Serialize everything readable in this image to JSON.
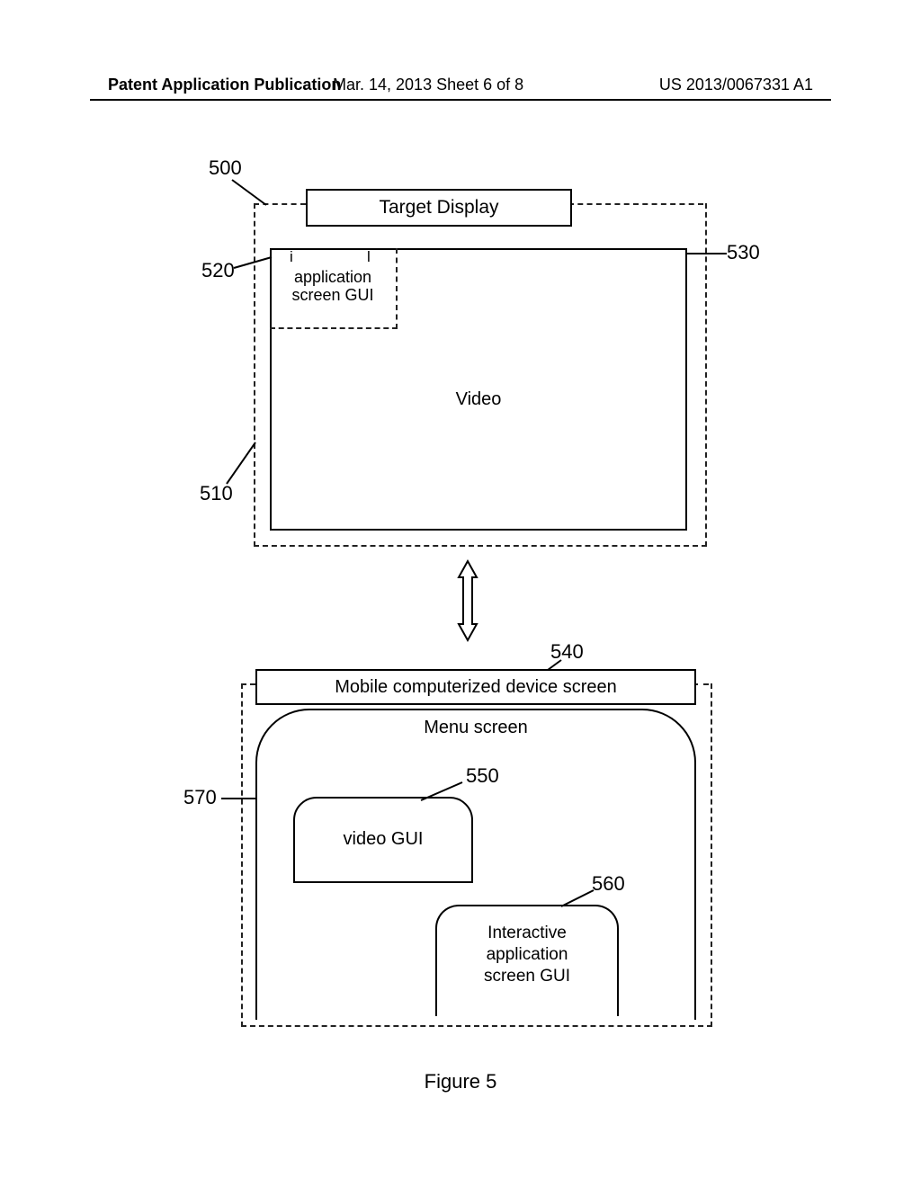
{
  "header": {
    "left": "Patent Application Publication",
    "center": "Mar. 14, 2013  Sheet 6 of 8",
    "right": "US 2013/0067331 A1"
  },
  "refs": {
    "r500": "500",
    "r520": "520",
    "r510": "510",
    "r530": "530",
    "r540": "540",
    "r570": "570",
    "r550": "550",
    "r560": "560"
  },
  "targetDisplay": {
    "title": "Target Display",
    "appGui": "application\nscreen GUI",
    "video": "Video"
  },
  "mobile": {
    "title": "Mobile computerized device  screen",
    "menu": "Menu screen",
    "videoGui": "video GUI",
    "interactive": "Interactive\napplication\nscreen GUI"
  },
  "figure": "Figure 5"
}
